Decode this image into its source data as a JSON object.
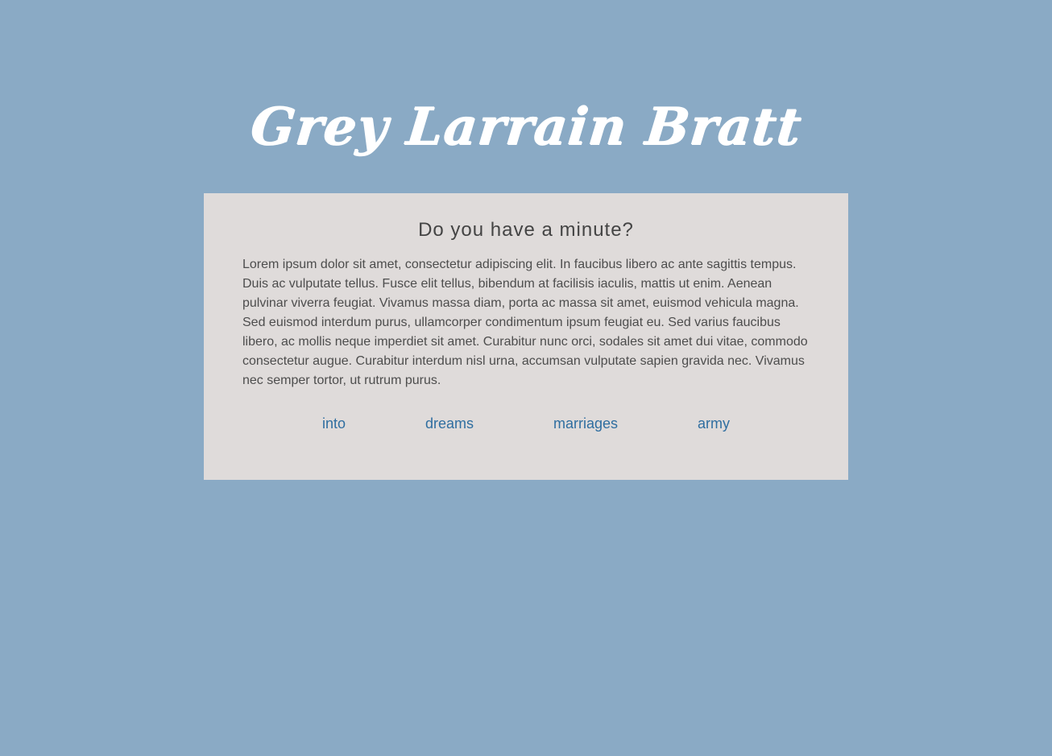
{
  "header": {
    "site_title": "Grey Larrain Bratt"
  },
  "card": {
    "heading": "Do you have a minute?",
    "body": "Lorem ipsum dolor sit amet, consectetur adipiscing elit. In faucibus libero ac ante sagittis tempus. Duis ac vulputate tellus. Fusce elit tellus, bibendum at facilisis iaculis, mattis ut enim. Aenean pulvinar viverra feugiat. Vivamus massa diam, porta ac massa sit amet, euismod vehicula magna. Sed euismod interdum purus, ullamcorper condimentum ipsum feugiat eu. Sed varius faucibus libero, ac mollis neque imperdiet sit amet. Curabitur nunc orci, sodales sit amet dui vitae, commodo consectetur augue. Curabitur interdum nisl urna, accumsan vulputate sapien gravida nec. Vivamus nec semper tortor, ut rutrum purus.",
    "links": [
      {
        "label": "into"
      },
      {
        "label": "dreams"
      },
      {
        "label": "marriages"
      },
      {
        "label": "army"
      }
    ]
  },
  "colors": {
    "page_background": "#8aaac5",
    "card_background": "#dfdbda",
    "link": "#2f6ea0",
    "heading_text": "#444444",
    "body_text": "#4d4d4d",
    "title_text": "#ffffff"
  }
}
